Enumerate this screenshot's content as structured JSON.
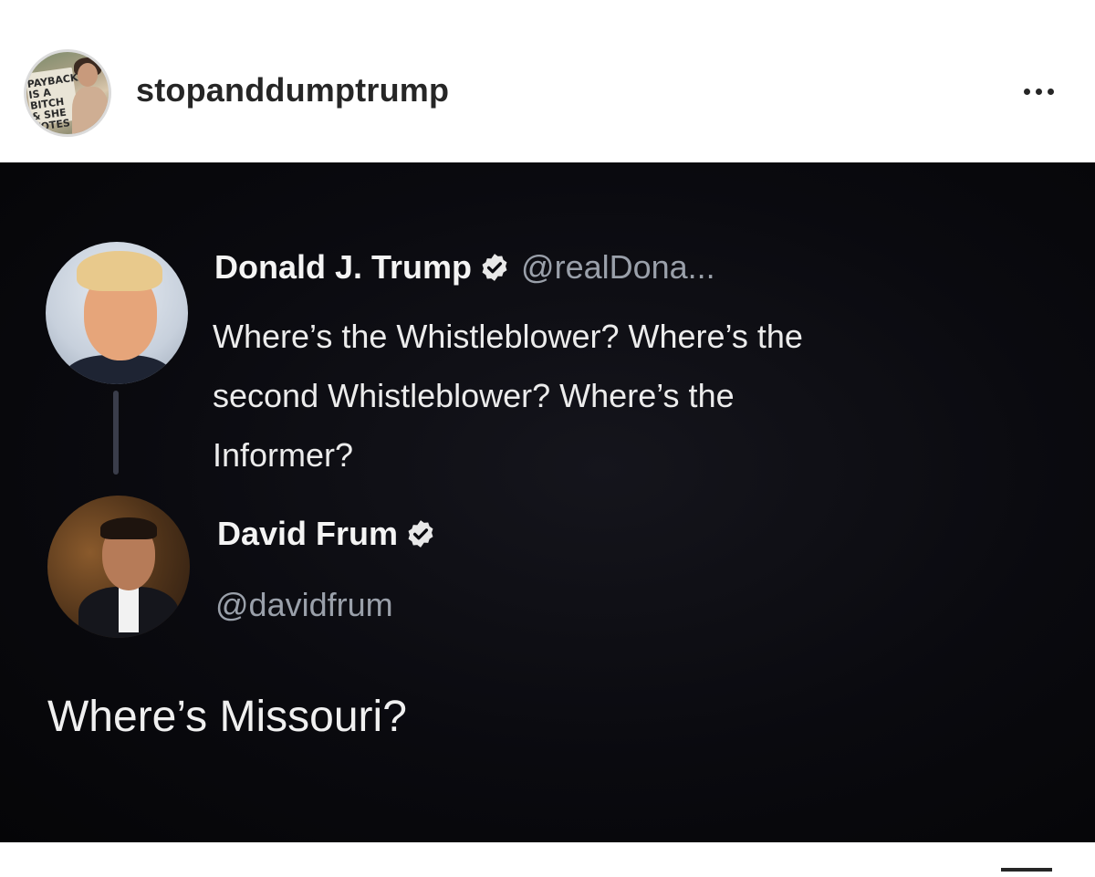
{
  "post_header": {
    "username": "stopanddumptrump",
    "avatar_icon": "profile-photo",
    "avatar_sign_text": "PAYBACK IS A BITCH & SHE VOTES",
    "more_icon": "more-options-icon"
  },
  "tweet": {
    "author_name": "Donald J. Trump",
    "handle": "@realDona...",
    "verified_icon": "verified-badge-icon",
    "lines": [
      "Where’s the Whistleblower? Where’s the",
      "second Whistleblower? Where’s the",
      "Informer?"
    ]
  },
  "reply": {
    "author_name": "David Frum",
    "handle": "@davidfrum",
    "verified_icon": "verified-badge-icon",
    "text": "Where’s Missouri?"
  },
  "colors": {
    "post_background": "#0a0a0f",
    "text_primary": "#ececec",
    "text_secondary": "#9aa0aa",
    "username": "#262626"
  }
}
